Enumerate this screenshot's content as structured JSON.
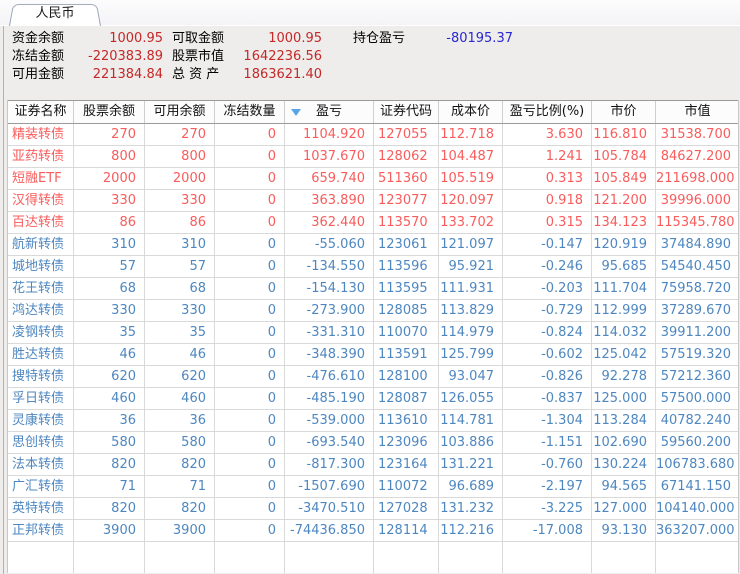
{
  "tab": {
    "label": "人民币"
  },
  "colors": {
    "summary_value_red": "#c42828",
    "summary_value_blue": "#2828d2",
    "table_profit_red": "#f95c5c",
    "table_loss_blue": "#4e87c0",
    "sort_arrow_blue": "#58a6e8"
  },
  "summary": {
    "rows": [
      {
        "pairs": [
          {
            "label": "资金余额",
            "value": "1000.95",
            "color": "red"
          },
          {
            "label": "可取金额",
            "value": "1000.95",
            "color": "red"
          },
          {
            "label": "持仓盈亏",
            "value": "-80195.37",
            "color": "blue"
          }
        ]
      },
      {
        "pairs": [
          {
            "label": "冻结金额",
            "value": "-220383.89",
            "color": "red"
          },
          {
            "label": "股票市值",
            "value": "1642236.56",
            "color": "red"
          }
        ]
      },
      {
        "pairs": [
          {
            "label": "可用金额",
            "value": "221384.84",
            "color": "red"
          },
          {
            "label": "总 资 产",
            "value": "1863621.40",
            "color": "red"
          }
        ]
      }
    ]
  },
  "table": {
    "columns": [
      {
        "key": "name",
        "label": "证券名称",
        "align": "left"
      },
      {
        "key": "balance",
        "label": "股票余额",
        "align": "num"
      },
      {
        "key": "available",
        "label": "可用余额",
        "align": "num"
      },
      {
        "key": "frozen",
        "label": "冻结数量",
        "align": "num"
      },
      {
        "key": "pl",
        "label": "盈亏",
        "align": "num",
        "sorted_desc": true
      },
      {
        "key": "code",
        "label": "证券代码",
        "align": "left"
      },
      {
        "key": "cost",
        "label": "成本价",
        "align": "num"
      },
      {
        "key": "pl_pct",
        "label": "盈亏比例(%)",
        "align": "num"
      },
      {
        "key": "price",
        "label": "市价",
        "align": "num"
      },
      {
        "key": "value",
        "label": "市值",
        "align": "num"
      }
    ],
    "positions": [
      {
        "name": "精装转债",
        "balance": "270",
        "available": "270",
        "frozen": "0",
        "pl": "1104.920",
        "code": "127055",
        "cost": "112.718",
        "pl_pct": "3.630",
        "price": "116.810",
        "value": "31538.700",
        "trend": "up"
      },
      {
        "name": "亚药转债",
        "balance": "800",
        "available": "800",
        "frozen": "0",
        "pl": "1037.670",
        "code": "128062",
        "cost": "104.487",
        "pl_pct": "1.241",
        "price": "105.784",
        "value": "84627.200",
        "trend": "up"
      },
      {
        "name": "短融ETF",
        "balance": "2000",
        "available": "2000",
        "frozen": "0",
        "pl": "659.740",
        "code": "511360",
        "cost": "105.519",
        "pl_pct": "0.313",
        "price": "105.849",
        "value": "211698.000",
        "trend": "up"
      },
      {
        "name": "汉得转债",
        "balance": "330",
        "available": "330",
        "frozen": "0",
        "pl": "363.890",
        "code": "123077",
        "cost": "120.097",
        "pl_pct": "0.918",
        "price": "121.200",
        "value": "39996.000",
        "trend": "up"
      },
      {
        "name": "百达转债",
        "balance": "86",
        "available": "86",
        "frozen": "0",
        "pl": "362.440",
        "code": "113570",
        "cost": "133.702",
        "pl_pct": "0.315",
        "price": "134.123",
        "value": "115345.780",
        "trend": "up"
      },
      {
        "name": "航新转债",
        "balance": "310",
        "available": "310",
        "frozen": "0",
        "pl": "-55.060",
        "code": "123061",
        "cost": "121.097",
        "pl_pct": "-0.147",
        "price": "120.919",
        "value": "37484.890",
        "trend": "down"
      },
      {
        "name": "城地转债",
        "balance": "57",
        "available": "57",
        "frozen": "0",
        "pl": "-134.550",
        "code": "113596",
        "cost": "95.921",
        "pl_pct": "-0.246",
        "price": "95.685",
        "value": "54540.450",
        "trend": "down"
      },
      {
        "name": "花王转债",
        "balance": "68",
        "available": "68",
        "frozen": "0",
        "pl": "-154.130",
        "code": "113595",
        "cost": "111.931",
        "pl_pct": "-0.203",
        "price": "111.704",
        "value": "75958.720",
        "trend": "down"
      },
      {
        "name": "鸿达转债",
        "balance": "330",
        "available": "330",
        "frozen": "0",
        "pl": "-273.900",
        "code": "128085",
        "cost": "113.829",
        "pl_pct": "-0.729",
        "price": "112.999",
        "value": "37289.670",
        "trend": "down"
      },
      {
        "name": "凌钢转债",
        "balance": "35",
        "available": "35",
        "frozen": "0",
        "pl": "-331.310",
        "code": "110070",
        "cost": "114.979",
        "pl_pct": "-0.824",
        "price": "114.032",
        "value": "39911.200",
        "trend": "down"
      },
      {
        "name": "胜达转债",
        "balance": "46",
        "available": "46",
        "frozen": "0",
        "pl": "-348.390",
        "code": "113591",
        "cost": "125.799",
        "pl_pct": "-0.602",
        "price": "125.042",
        "value": "57519.320",
        "trend": "down"
      },
      {
        "name": "搜特转债",
        "balance": "620",
        "available": "620",
        "frozen": "0",
        "pl": "-476.610",
        "code": "128100",
        "cost": "93.047",
        "pl_pct": "-0.826",
        "price": "92.278",
        "value": "57212.360",
        "trend": "down"
      },
      {
        "name": "孚日转债",
        "balance": "460",
        "available": "460",
        "frozen": "0",
        "pl": "-485.190",
        "code": "128087",
        "cost": "126.055",
        "pl_pct": "-0.837",
        "price": "125.000",
        "value": "57500.000",
        "trend": "down"
      },
      {
        "name": "灵康转债",
        "balance": "36",
        "available": "36",
        "frozen": "0",
        "pl": "-539.000",
        "code": "113610",
        "cost": "114.781",
        "pl_pct": "-1.304",
        "price": "113.284",
        "value": "40782.240",
        "trend": "down"
      },
      {
        "name": "思创转债",
        "balance": "580",
        "available": "580",
        "frozen": "0",
        "pl": "-693.540",
        "code": "123096",
        "cost": "103.886",
        "pl_pct": "-1.151",
        "price": "102.690",
        "value": "59560.200",
        "trend": "down"
      },
      {
        "name": "法本转债",
        "balance": "820",
        "available": "820",
        "frozen": "0",
        "pl": "-817.300",
        "code": "123164",
        "cost": "131.221",
        "pl_pct": "-0.760",
        "price": "130.224",
        "value": "106783.680",
        "trend": "down"
      },
      {
        "name": "广汇转债",
        "balance": "71",
        "available": "71",
        "frozen": "0",
        "pl": "-1507.690",
        "code": "110072",
        "cost": "96.689",
        "pl_pct": "-2.197",
        "price": "94.565",
        "value": "67141.150",
        "trend": "down"
      },
      {
        "name": "英特转债",
        "balance": "820",
        "available": "820",
        "frozen": "0",
        "pl": "-3470.510",
        "code": "127028",
        "cost": "131.232",
        "pl_pct": "-3.225",
        "price": "127.000",
        "value": "104140.000",
        "trend": "down"
      },
      {
        "name": "正邦转债",
        "balance": "3900",
        "available": "3900",
        "frozen": "0",
        "pl": "-74436.850",
        "code": "128114",
        "cost": "112.216",
        "pl_pct": "-17.008",
        "price": "93.130",
        "value": "363207.000",
        "trend": "down"
      }
    ]
  }
}
